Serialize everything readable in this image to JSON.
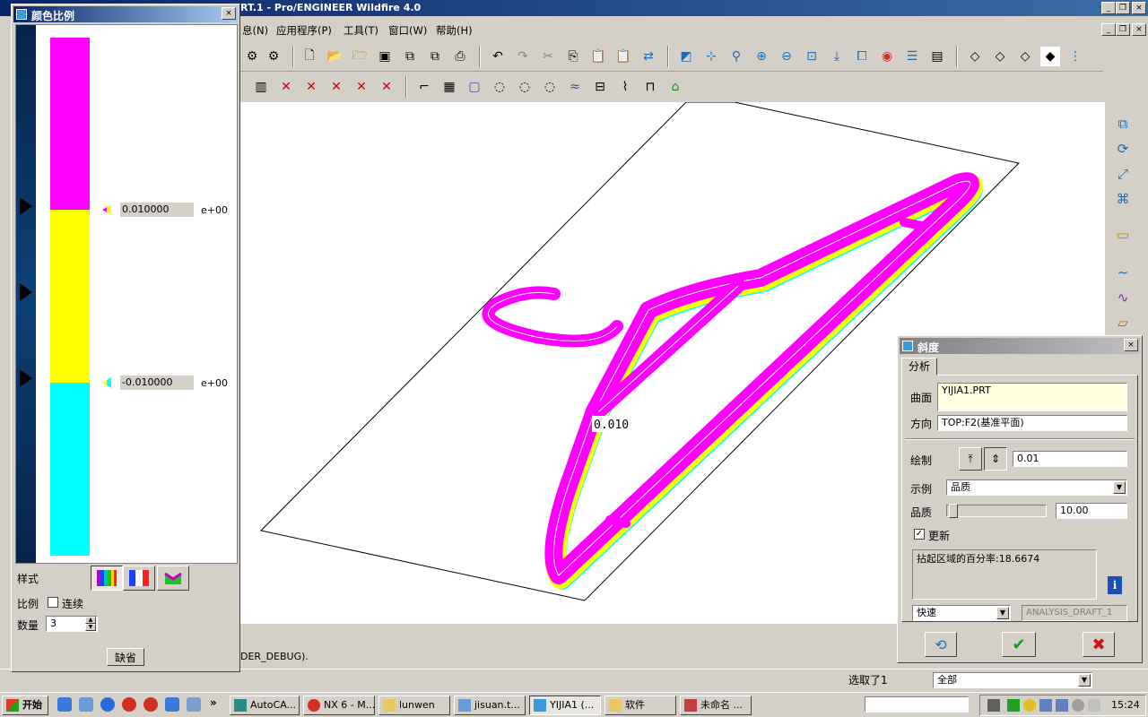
{
  "app": {
    "title_fragment": "RT.1 - Pro/ENGINEER Wildfire 4.0"
  },
  "menu": {
    "items": [
      "息(N)",
      "应用程序(P)",
      "工具(T)",
      "窗口(W)",
      "帮助(H)"
    ]
  },
  "graphics": {
    "annotation": "0.010"
  },
  "message": {
    "text": "DER_DEBUG)."
  },
  "status": {
    "selection": "选取了1",
    "filter": "全部"
  },
  "color_scale": {
    "title": "颜色比例",
    "upper_value": "0.010000",
    "lower_value": "-0.010000",
    "exponent": "e+00",
    "colors": {
      "top": "#ff00ff",
      "middle": "#ffff00",
      "bottom": "#00ffff"
    },
    "style_label": "样式",
    "ratio_label": "比例",
    "continuous_label": "连续",
    "continuous_checked": false,
    "count_label": "数量",
    "count_value": "3",
    "default_button": "缺省"
  },
  "draft": {
    "title": "斜度",
    "tab": "分析",
    "surface_label": "曲面",
    "surface_value": "YIJIA1.PRT",
    "direction_label": "方向",
    "direction_value": "TOP:F2(基准平面)",
    "draw_label": "绘制",
    "draw_value": "0.01",
    "example_label": "示例",
    "example_value": "品质",
    "quality_label": "品质",
    "quality_value": "10.00",
    "update_label": "更新",
    "update_checked": true,
    "result_text": "拈起区域的百分率:18.6674",
    "mode_value": "快速",
    "analysis_name": "ANALYSIS_DRAFT_1"
  },
  "taskbar": {
    "start": "开始",
    "tasks": [
      "AutoCA...",
      "NX 6 - M...",
      "lunwen",
      "jisuan.t...",
      "YIJIA1 (...",
      "软件",
      "未命名 ..."
    ],
    "clock": "15:24"
  }
}
